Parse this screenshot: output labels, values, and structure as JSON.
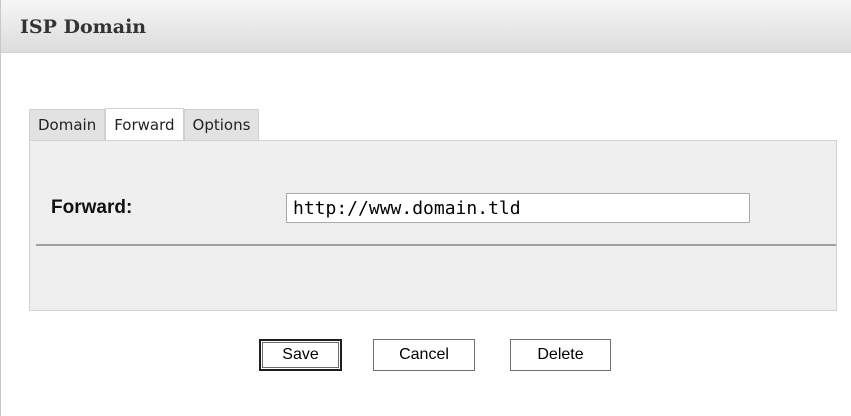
{
  "header": {
    "title": "ISP Domain"
  },
  "tabs": [
    {
      "label": "Domain",
      "active": false
    },
    {
      "label": "Forward",
      "active": true
    },
    {
      "label": "Options",
      "active": false
    }
  ],
  "form": {
    "forward_label": "Forward:",
    "forward_value": "http://www.domain.tld"
  },
  "buttons": {
    "save_label": "Save",
    "cancel_label": "Cancel",
    "delete_label": "Delete"
  }
}
